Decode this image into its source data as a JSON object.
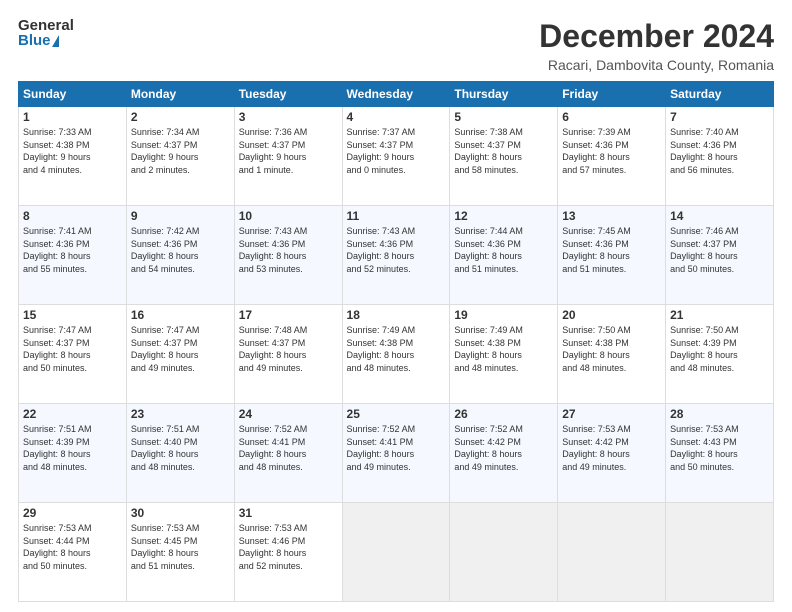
{
  "logo": {
    "line1": "General",
    "line2": "Blue"
  },
  "title": "December 2024",
  "subtitle": "Racari, Dambovita County, Romania",
  "days_header": [
    "Sunday",
    "Monday",
    "Tuesday",
    "Wednesday",
    "Thursday",
    "Friday",
    "Saturday"
  ],
  "weeks": [
    [
      {
        "day": "1",
        "info": "Sunrise: 7:33 AM\nSunset: 4:38 PM\nDaylight: 9 hours\nand 4 minutes."
      },
      {
        "day": "2",
        "info": "Sunrise: 7:34 AM\nSunset: 4:37 PM\nDaylight: 9 hours\nand 2 minutes."
      },
      {
        "day": "3",
        "info": "Sunrise: 7:36 AM\nSunset: 4:37 PM\nDaylight: 9 hours\nand 1 minute."
      },
      {
        "day": "4",
        "info": "Sunrise: 7:37 AM\nSunset: 4:37 PM\nDaylight: 9 hours\nand 0 minutes."
      },
      {
        "day": "5",
        "info": "Sunrise: 7:38 AM\nSunset: 4:37 PM\nDaylight: 8 hours\nand 58 minutes."
      },
      {
        "day": "6",
        "info": "Sunrise: 7:39 AM\nSunset: 4:36 PM\nDaylight: 8 hours\nand 57 minutes."
      },
      {
        "day": "7",
        "info": "Sunrise: 7:40 AM\nSunset: 4:36 PM\nDaylight: 8 hours\nand 56 minutes."
      }
    ],
    [
      {
        "day": "8",
        "info": "Sunrise: 7:41 AM\nSunset: 4:36 PM\nDaylight: 8 hours\nand 55 minutes."
      },
      {
        "day": "9",
        "info": "Sunrise: 7:42 AM\nSunset: 4:36 PM\nDaylight: 8 hours\nand 54 minutes."
      },
      {
        "day": "10",
        "info": "Sunrise: 7:43 AM\nSunset: 4:36 PM\nDaylight: 8 hours\nand 53 minutes."
      },
      {
        "day": "11",
        "info": "Sunrise: 7:43 AM\nSunset: 4:36 PM\nDaylight: 8 hours\nand 52 minutes."
      },
      {
        "day": "12",
        "info": "Sunrise: 7:44 AM\nSunset: 4:36 PM\nDaylight: 8 hours\nand 51 minutes."
      },
      {
        "day": "13",
        "info": "Sunrise: 7:45 AM\nSunset: 4:36 PM\nDaylight: 8 hours\nand 51 minutes."
      },
      {
        "day": "14",
        "info": "Sunrise: 7:46 AM\nSunset: 4:37 PM\nDaylight: 8 hours\nand 50 minutes."
      }
    ],
    [
      {
        "day": "15",
        "info": "Sunrise: 7:47 AM\nSunset: 4:37 PM\nDaylight: 8 hours\nand 50 minutes."
      },
      {
        "day": "16",
        "info": "Sunrise: 7:47 AM\nSunset: 4:37 PM\nDaylight: 8 hours\nand 49 minutes."
      },
      {
        "day": "17",
        "info": "Sunrise: 7:48 AM\nSunset: 4:37 PM\nDaylight: 8 hours\nand 49 minutes."
      },
      {
        "day": "18",
        "info": "Sunrise: 7:49 AM\nSunset: 4:38 PM\nDaylight: 8 hours\nand 48 minutes."
      },
      {
        "day": "19",
        "info": "Sunrise: 7:49 AM\nSunset: 4:38 PM\nDaylight: 8 hours\nand 48 minutes."
      },
      {
        "day": "20",
        "info": "Sunrise: 7:50 AM\nSunset: 4:38 PM\nDaylight: 8 hours\nand 48 minutes."
      },
      {
        "day": "21",
        "info": "Sunrise: 7:50 AM\nSunset: 4:39 PM\nDaylight: 8 hours\nand 48 minutes."
      }
    ],
    [
      {
        "day": "22",
        "info": "Sunrise: 7:51 AM\nSunset: 4:39 PM\nDaylight: 8 hours\nand 48 minutes."
      },
      {
        "day": "23",
        "info": "Sunrise: 7:51 AM\nSunset: 4:40 PM\nDaylight: 8 hours\nand 48 minutes."
      },
      {
        "day": "24",
        "info": "Sunrise: 7:52 AM\nSunset: 4:41 PM\nDaylight: 8 hours\nand 48 minutes."
      },
      {
        "day": "25",
        "info": "Sunrise: 7:52 AM\nSunset: 4:41 PM\nDaylight: 8 hours\nand 49 minutes."
      },
      {
        "day": "26",
        "info": "Sunrise: 7:52 AM\nSunset: 4:42 PM\nDaylight: 8 hours\nand 49 minutes."
      },
      {
        "day": "27",
        "info": "Sunrise: 7:53 AM\nSunset: 4:42 PM\nDaylight: 8 hours\nand 49 minutes."
      },
      {
        "day": "28",
        "info": "Sunrise: 7:53 AM\nSunset: 4:43 PM\nDaylight: 8 hours\nand 50 minutes."
      }
    ],
    [
      {
        "day": "29",
        "info": "Sunrise: 7:53 AM\nSunset: 4:44 PM\nDaylight: 8 hours\nand 50 minutes."
      },
      {
        "day": "30",
        "info": "Sunrise: 7:53 AM\nSunset: 4:45 PM\nDaylight: 8 hours\nand 51 minutes."
      },
      {
        "day": "31",
        "info": "Sunrise: 7:53 AM\nSunset: 4:46 PM\nDaylight: 8 hours\nand 52 minutes."
      },
      {
        "day": "",
        "info": ""
      },
      {
        "day": "",
        "info": ""
      },
      {
        "day": "",
        "info": ""
      },
      {
        "day": "",
        "info": ""
      }
    ]
  ]
}
